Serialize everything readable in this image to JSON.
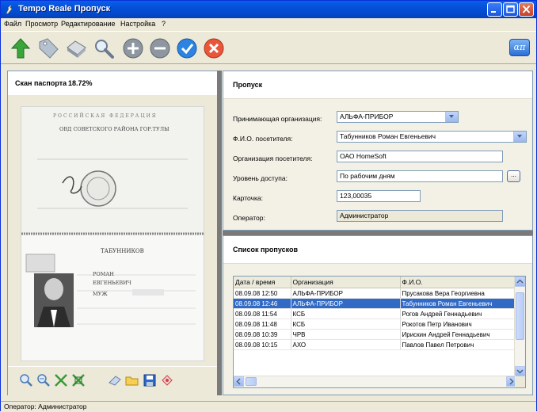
{
  "window": {
    "title": "Tempo Reale Пропуск",
    "buttons": [
      "minimize-icon",
      "maximize-icon",
      "close-icon"
    ]
  },
  "menu": {
    "items": [
      "Файл",
      "Просмотр",
      "Редактирование",
      "Настройка",
      "?"
    ]
  },
  "toolbar": {
    "icons": [
      "up-arrow-icon",
      "tag-icon",
      "scanner-icon",
      "search-icon",
      "add-icon",
      "remove-icon",
      "confirm-icon",
      "cancel-icon"
    ],
    "brand_icon": "alpha-pi-logo-icon",
    "brand_text": "απ"
  },
  "scan": {
    "title": "Скан паспорта",
    "progress": "18.72%",
    "tools": [
      "zoom-in-icon",
      "zoom-out-icon",
      "fit-icon",
      "crop-icon",
      "erase-icon",
      "open-folder-icon",
      "save-icon",
      "clear-icon"
    ],
    "passport_lines": [
      "РОССИЙСКАЯ ФЕДЕРАЦИЯ",
      "ОВД СОВЕТСКОГО РАЙОНА ГОР.ТУЛЫ",
      "ТАБУННИКОВ",
      "РОМАН",
      "ЕВГЕНЬЕВИЧ",
      "МУЖ"
    ]
  },
  "form": {
    "title": "Пропуск",
    "fields": [
      {
        "label": "Принимающая организация:",
        "value": "АЛЬФА-ПРИБОР",
        "kind": "combo"
      },
      {
        "label": "Ф.И.О. посетителя:",
        "value": "Табунников Роман Евгеньевич",
        "kind": "combo"
      },
      {
        "label": "Организация посетителя:",
        "value": "ОАО HomeSoft",
        "kind": "text"
      },
      {
        "label": "Уровень доступа:",
        "value": "По рабочим дням",
        "kind": "browse"
      },
      {
        "label": "Карточка:",
        "value": "123,00035",
        "kind": "text"
      },
      {
        "label": "Оператор:",
        "value": "Администратор",
        "kind": "readonly"
      }
    ],
    "browse_label": "..."
  },
  "list": {
    "title": "Список пропусков",
    "columns": [
      "Дата / время",
      "Организация",
      "Ф.И.О."
    ],
    "selected_row": 1,
    "rows": [
      [
        "08.09.08 12:50",
        "АЛЬФА-ПРИБОР",
        "Прусакова Вера Георгиевна"
      ],
      [
        "08.09.08 12:46",
        "АЛЬФА-ПРИБОР",
        "Табунников Роман Евгеньевич"
      ],
      [
        "08.09.08 11:54",
        "КСБ",
        "Рогов Андрей Геннадьевич"
      ],
      [
        "08.09.08 11:48",
        "КСБ",
        "Рокотов Петр Иванович"
      ],
      [
        "08.09.08 10:39",
        "ЧРВ",
        "Ирискин Андрей Геннадьевич"
      ],
      [
        "08.09.08 10:15",
        "АХО",
        "Павлов Павел Петрович"
      ]
    ]
  },
  "statusbar": {
    "text": "Оператор: Администратор"
  }
}
